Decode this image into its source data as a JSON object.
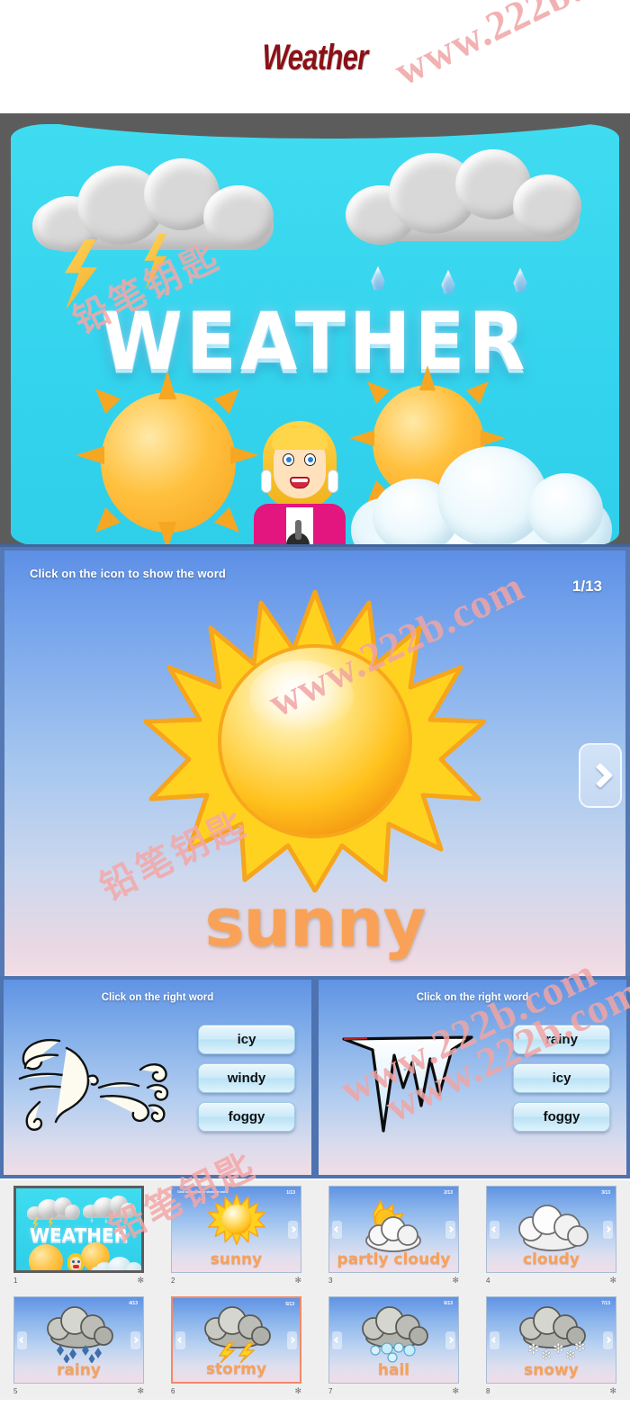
{
  "document": {
    "title": "Weather"
  },
  "watermark": {
    "english": "www.222b.com",
    "chinese": "铅笔钥匙",
    "color": "#f0a5a5"
  },
  "hero_slide": {
    "wordart": "WEATHER",
    "background_color": "#3fdcf0",
    "frame_color": "#5d5c5c"
  },
  "main_slide": {
    "hint": "Click on the icon to show the word",
    "counter": "1/13",
    "word": "sunny",
    "word_color": "#f9a257",
    "next_button": "next-arrow"
  },
  "quiz_panels": [
    {
      "hint": "Click on the right word",
      "icon": "windy-face-icon",
      "choices": [
        "icy",
        "windy",
        "foggy"
      ]
    },
    {
      "hint": "Click on the right word",
      "icon": "icicle-icon",
      "choices": [
        "rainy",
        "icy",
        "foggy"
      ]
    }
  ],
  "thumbnails": [
    {
      "number": "1",
      "label": "",
      "counter": "",
      "hint": "",
      "kind": "title",
      "selected": false,
      "star": "✻"
    },
    {
      "number": "2",
      "label": "sunny",
      "counter": "1/13",
      "hint": "Click on the icon to show the word",
      "kind": "sunny",
      "selected": false,
      "star": "✻"
    },
    {
      "number": "3",
      "label": "partly cloudy",
      "counter": "2/13",
      "hint": "",
      "kind": "partly-cloudy",
      "selected": false,
      "star": "✻"
    },
    {
      "number": "4",
      "label": "cloudy",
      "counter": "3/13",
      "hint": "",
      "kind": "cloudy",
      "selected": false,
      "star": "✻"
    },
    {
      "number": "5",
      "label": "rainy",
      "counter": "4/13",
      "hint": "",
      "kind": "rainy",
      "selected": false,
      "star": "✻"
    },
    {
      "number": "6",
      "label": "stormy",
      "counter": "5/13",
      "hint": "",
      "kind": "stormy",
      "selected": true,
      "star": "✻"
    },
    {
      "number": "7",
      "label": "hail",
      "counter": "6/13",
      "hint": "",
      "kind": "hail",
      "selected": false,
      "star": "✻"
    },
    {
      "number": "8",
      "label": "snowy",
      "counter": "7/13",
      "hint": "",
      "kind": "snowy",
      "selected": false,
      "star": "✻"
    }
  ]
}
